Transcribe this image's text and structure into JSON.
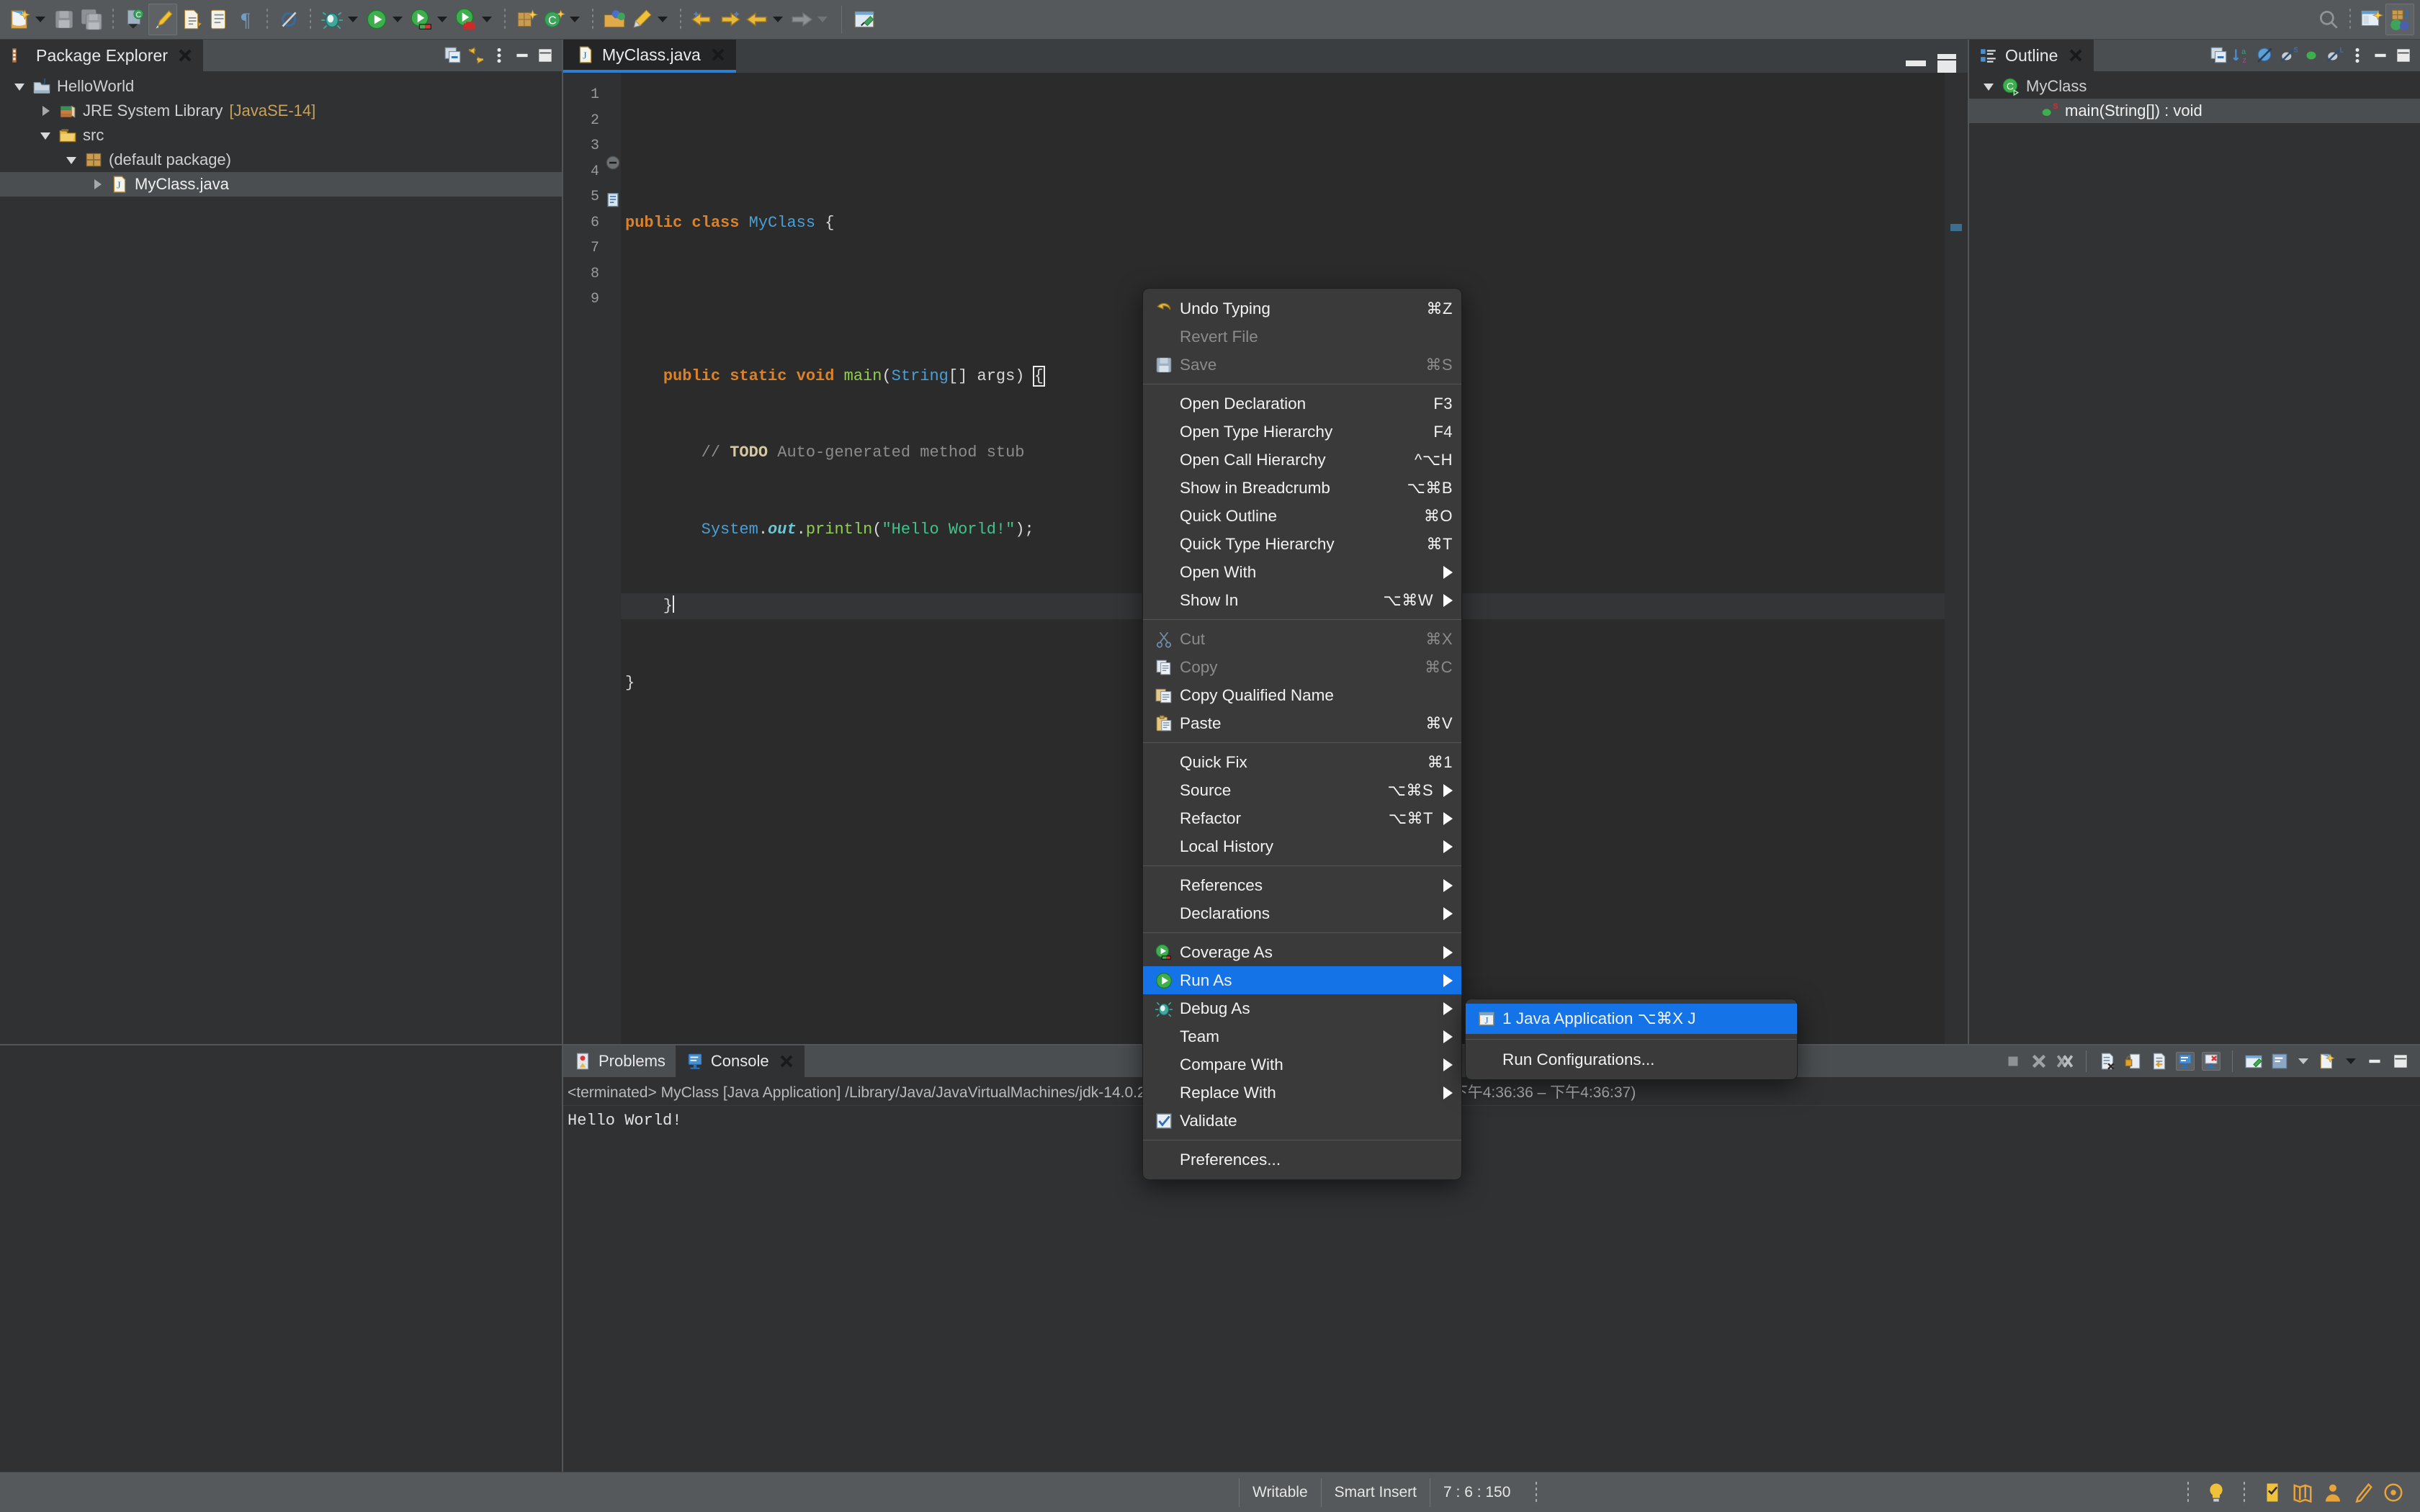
{
  "toolbar": {
    "icons": [
      {
        "name": "new-wizard-icon",
        "has_arrow": true
      },
      {
        "name": "save-icon",
        "has_arrow": false
      },
      {
        "name": "save-all-icon",
        "has_arrow": false
      },
      {
        "name": "sep",
        "has_arrow": false
      },
      {
        "name": "new-java-class-icon",
        "has_arrow": false
      },
      {
        "name": "highlight-marker-icon",
        "has_arrow": false
      },
      {
        "name": "next-annotation-icon",
        "has_arrow": false
      },
      {
        "name": "previous-annotation-icon",
        "has_arrow": false
      },
      {
        "name": "show-whitespace-icon",
        "has_arrow": false
      },
      {
        "name": "sep",
        "has_arrow": false
      },
      {
        "name": "skip-all-breakpoints-icon",
        "has_arrow": false
      },
      {
        "name": "sep",
        "has_arrow": false
      },
      {
        "name": "debug-icon",
        "has_arrow": true
      },
      {
        "name": "run-icon",
        "has_arrow": true
      },
      {
        "name": "coverage-icon",
        "has_arrow": true
      },
      {
        "name": "run-ant-icon",
        "has_arrow": true
      },
      {
        "name": "sep",
        "has_arrow": false
      },
      {
        "name": "new-java-project-icon",
        "has_arrow": false
      },
      {
        "name": "new-class-icon",
        "has_arrow": true
      },
      {
        "name": "sep",
        "has_arrow": false
      },
      {
        "name": "open-type-icon",
        "has_arrow": false
      },
      {
        "name": "search-pen-icon",
        "has_arrow": true
      },
      {
        "name": "sep",
        "has_arrow": false
      },
      {
        "name": "previous-edit-location-icon",
        "has_arrow": false
      },
      {
        "name": "next-edit-location-icon",
        "has_arrow": false
      },
      {
        "name": "back-icon",
        "has_arrow": true
      },
      {
        "name": "forward-icon",
        "has_arrow": true
      },
      {
        "name": "sep-line",
        "has_arrow": false
      },
      {
        "name": "pin-editor-icon",
        "has_arrow": false
      }
    ],
    "right_icons": [
      {
        "name": "search-icon"
      },
      {
        "name": "dots-separator"
      },
      {
        "name": "open-perspective-icon"
      },
      {
        "name": "java-perspective-icon"
      }
    ]
  },
  "package_explorer": {
    "title": "Package Explorer",
    "toolbar_icons": [
      "collapse-all-icon",
      "link-with-editor-icon",
      "view-menu-icon",
      "minimize-icon",
      "maximize-icon"
    ],
    "tree": [
      {
        "label": "HelloWorld",
        "icon": "java-project-icon",
        "indent": 0,
        "twisty": "open",
        "selected": false,
        "suffix": ""
      },
      {
        "label": "JRE System Library",
        "icon": "library-icon",
        "indent": 1,
        "twisty": "closed",
        "selected": false,
        "suffix": "[JavaSE-14]"
      },
      {
        "label": "src",
        "icon": "source-folder-icon",
        "indent": 1,
        "twisty": "open",
        "selected": false,
        "suffix": ""
      },
      {
        "label": "(default package)",
        "icon": "package-icon",
        "indent": 2,
        "twisty": "open",
        "selected": false,
        "suffix": ""
      },
      {
        "label": "MyClass.java",
        "icon": "java-file-icon",
        "indent": 3,
        "twisty": "closed",
        "selected": true,
        "suffix": ""
      }
    ]
  },
  "editor": {
    "tab_label": "MyClass.java",
    "tab_icon": "java-file-icon",
    "minimize_label": "minimize",
    "maximize_label": "maximize",
    "line_numbers": [
      "1",
      "2",
      "3",
      "4",
      "5",
      "6",
      "7",
      "8",
      "9"
    ],
    "code_lines": [
      {
        "n": "1",
        "text": ""
      },
      {
        "n": "2",
        "text": "public class MyClass {"
      },
      {
        "n": "3",
        "text": ""
      },
      {
        "n": "4",
        "text": "    public static void main(String[] args) {"
      },
      {
        "n": "5",
        "text": "        // TODO Auto-generated method stub"
      },
      {
        "n": "6",
        "text": "        System.out.println(\"Hello World!\");"
      },
      {
        "n": "7",
        "text": "    }"
      },
      {
        "n": "8",
        "text": "}"
      },
      {
        "n": "9",
        "text": ""
      }
    ]
  },
  "outline": {
    "title": "Outline",
    "toolbar_icons": [
      "collapse-all-icon",
      "sort-icon",
      "hide-fields-icon",
      "hide-static-icon",
      "hide-nonpublic-icon",
      "hide-local-types-icon",
      "view-menu-icon",
      "minimize-icon",
      "maximize-icon"
    ],
    "tree": [
      {
        "label": "MyClass",
        "icon": "class-icon",
        "indent": 0,
        "twisty": "open",
        "selected": false
      },
      {
        "label": "main(String[]) : void",
        "icon": "method-static-icon",
        "indent": 1,
        "twisty": "none",
        "selected": true
      }
    ]
  },
  "console": {
    "tabs": [
      {
        "label": "Problems",
        "icon": "problems-icon",
        "active": false
      },
      {
        "label": "Console",
        "icon": "console-icon",
        "active": true
      }
    ],
    "header": "<terminated> MyClass [Java Application] /Library/Java/JavaVirtualMachines/jdk-14.0.2.jdk/Contents/Home/bin/java  (2020年9月29日 下午4:36:36 – 下午4:36:37)",
    "output": "Hello World!",
    "toolbar_icons": [
      "terminate-icon",
      "remove-launch-icon",
      "remove-all-terminated-icon",
      "clear-console-icon",
      "scroll-lock-icon",
      "word-wrap-icon",
      "show-console-on-output-icon",
      "show-console-error-icon",
      "pin-console-icon",
      "display-selected-console-icon",
      "open-console-icon",
      "minimize-icon",
      "maximize-icon"
    ]
  },
  "context_menu": {
    "items": [
      {
        "label": "Undo Typing",
        "accel": "⌘Z",
        "icon": "undo-icon",
        "disabled": false,
        "submenu": false
      },
      {
        "label": "Revert File",
        "accel": "",
        "icon": "",
        "disabled": true,
        "submenu": false
      },
      {
        "label": "Save",
        "accel": "⌘S",
        "icon": "save-icon",
        "disabled": true,
        "submenu": false
      },
      {
        "type": "separator"
      },
      {
        "label": "Open Declaration",
        "accel": "F3",
        "icon": "",
        "disabled": false,
        "submenu": false
      },
      {
        "label": "Open Type Hierarchy",
        "accel": "F4",
        "icon": "",
        "disabled": false,
        "submenu": false
      },
      {
        "label": "Open Call Hierarchy",
        "accel": "^⌥H",
        "icon": "",
        "disabled": false,
        "submenu": false
      },
      {
        "label": "Show in Breadcrumb",
        "accel": "⌥⌘B",
        "icon": "",
        "disabled": false,
        "submenu": false
      },
      {
        "label": "Quick Outline",
        "accel": "⌘O",
        "icon": "",
        "disabled": false,
        "submenu": false
      },
      {
        "label": "Quick Type Hierarchy",
        "accel": "⌘T",
        "icon": "",
        "disabled": false,
        "submenu": false
      },
      {
        "label": "Open With",
        "accel": "",
        "icon": "",
        "disabled": false,
        "submenu": true
      },
      {
        "label": "Show In",
        "accel": "⌥⌘W",
        "icon": "",
        "disabled": false,
        "submenu": true
      },
      {
        "type": "separator"
      },
      {
        "label": "Cut",
        "accel": "⌘X",
        "icon": "cut-icon",
        "disabled": true,
        "submenu": false
      },
      {
        "label": "Copy",
        "accel": "⌘C",
        "icon": "copy-icon",
        "disabled": true,
        "submenu": false
      },
      {
        "label": "Copy Qualified Name",
        "accel": "",
        "icon": "copy-qualified-icon",
        "disabled": false,
        "submenu": false
      },
      {
        "label": "Paste",
        "accel": "⌘V",
        "icon": "paste-icon",
        "disabled": false,
        "submenu": false
      },
      {
        "type": "separator"
      },
      {
        "label": "Quick Fix",
        "accel": "⌘1",
        "icon": "",
        "disabled": false,
        "submenu": false
      },
      {
        "label": "Source",
        "accel": "⌥⌘S",
        "icon": "",
        "disabled": false,
        "submenu": true
      },
      {
        "label": "Refactor",
        "accel": "⌥⌘T",
        "icon": "",
        "disabled": false,
        "submenu": true
      },
      {
        "label": "Local History",
        "accel": "",
        "icon": "",
        "disabled": false,
        "submenu": true
      },
      {
        "type": "separator"
      },
      {
        "label": "References",
        "accel": "",
        "icon": "",
        "disabled": false,
        "submenu": true
      },
      {
        "label": "Declarations",
        "accel": "",
        "icon": "",
        "disabled": false,
        "submenu": true
      },
      {
        "type": "separator"
      },
      {
        "label": "Coverage As",
        "accel": "",
        "icon": "coverage-icon",
        "disabled": false,
        "submenu": true
      },
      {
        "label": "Run As",
        "accel": "",
        "icon": "run-icon",
        "disabled": false,
        "submenu": true,
        "highlight": true
      },
      {
        "label": "Debug As",
        "accel": "",
        "icon": "debug-icon",
        "disabled": false,
        "submenu": true
      },
      {
        "label": "Team",
        "accel": "",
        "icon": "",
        "disabled": false,
        "submenu": true
      },
      {
        "label": "Compare With",
        "accel": "",
        "icon": "",
        "disabled": false,
        "submenu": true
      },
      {
        "label": "Replace With",
        "accel": "",
        "icon": "",
        "disabled": false,
        "submenu": true
      },
      {
        "label": "Validate",
        "accel": "",
        "icon": "checkbox-checked-icon",
        "disabled": false,
        "submenu": false
      },
      {
        "type": "separator"
      },
      {
        "label": "Preferences...",
        "accel": "",
        "icon": "",
        "disabled": false,
        "submenu": false
      }
    ]
  },
  "run_as_submenu": {
    "items": [
      {
        "label": "1 Java Application ⌥⌘X J",
        "icon": "java-app-icon",
        "highlight": true
      },
      {
        "type": "separator"
      },
      {
        "label": "Run Configurations...",
        "icon": "",
        "highlight": false
      }
    ]
  },
  "statusbar": {
    "writable": "Writable",
    "insert_mode": "Smart Insert",
    "position": "7 : 6 : 150",
    "right_icons": [
      "lightbulb-icon",
      "quick-access-icon",
      "map-icon",
      "person-icon",
      "pen-icon",
      "target-icon"
    ]
  },
  "colors": {
    "toolbar_bg": "#56595b",
    "panel_bg": "#4a4e50",
    "view_bg": "#2f3132",
    "editor_bg": "#2b2b2b",
    "menu_bg": "#3a3a3a",
    "highlight_blue": "#1473e6",
    "tab_underline": "#2d7fd4",
    "keyword": "#d9822b",
    "type": "#4a9fd6",
    "method": "#8fd14f",
    "string": "#3fc48b",
    "comment": "#8c8c8c"
  }
}
